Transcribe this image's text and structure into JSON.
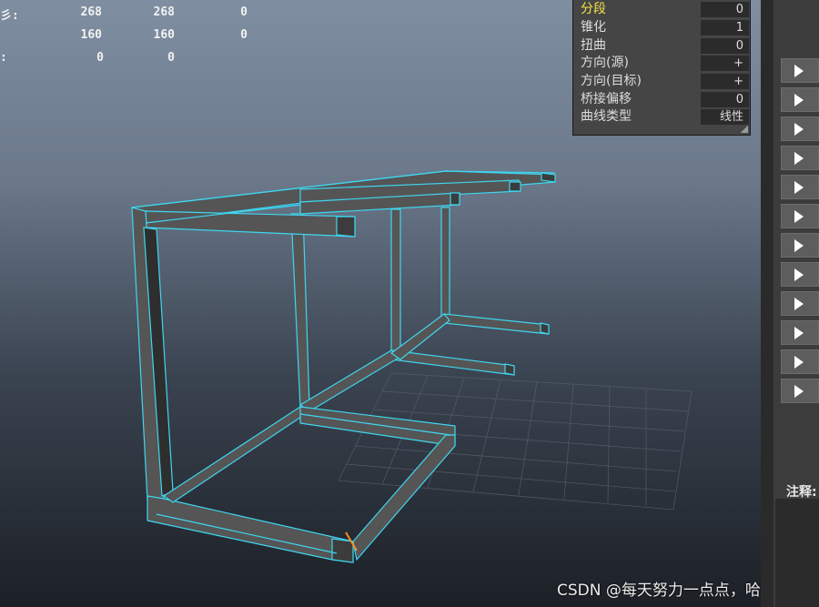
{
  "hud": {
    "rows": [
      {
        "label": "彡:",
        "values": [
          "268",
          "268",
          "0"
        ]
      },
      {
        "label": "",
        "values": [
          "160",
          "160",
          "0"
        ]
      },
      {
        "label": ":",
        "values": [
          "0",
          "0"
        ]
      }
    ]
  },
  "attributes_panel": {
    "rows": [
      {
        "label": "分段",
        "value": "0",
        "highlighted": true
      },
      {
        "label": "锥化",
        "value": "1"
      },
      {
        "label": "扭曲",
        "value": "0"
      },
      {
        "label": "方向(源)",
        "value": "+"
      },
      {
        "label": "方向(目标)",
        "value": "+"
      },
      {
        "label": "桥接偏移",
        "value": "0"
      },
      {
        "label": "曲线类型",
        "value": "线性"
      }
    ]
  },
  "right_bar": {
    "button_count": 12,
    "notes_label": "注释:"
  },
  "viewport": {
    "wireframe_color": "#3fd6f0",
    "surface_color": "#555555"
  },
  "watermark": "CSDN @每天努力一点点，哈哈"
}
